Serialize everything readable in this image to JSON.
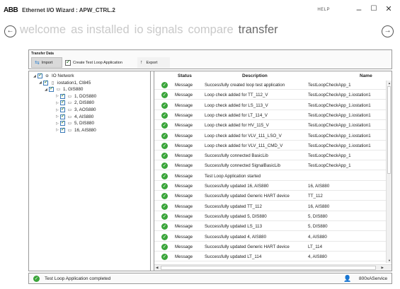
{
  "window": {
    "logo": "ABB",
    "title": "Ethernet I/O Wizard : APW_CTRL.2",
    "help": "HELP"
  },
  "nav": {
    "steps": [
      {
        "label": "welcome",
        "active": false
      },
      {
        "label": "as installed",
        "active": false
      },
      {
        "label": "io signals",
        "active": false
      },
      {
        "label": "compare",
        "active": false
      },
      {
        "label": "transfer",
        "active": true
      }
    ]
  },
  "transfer_data": {
    "title": "Transfer Data",
    "import_label": "Import",
    "create_test_loop_label": "Create Test Loop Application",
    "create_test_loop_checked": true,
    "export_label": "Export"
  },
  "tree": [
    {
      "label": "IO Network",
      "level": 0,
      "expanded": true
    },
    {
      "label": "iostation1, CI845",
      "level": 1,
      "expanded": true
    },
    {
      "label": "1, GIS880",
      "level": 2,
      "expanded": true
    },
    {
      "label": "1, DOS880",
      "level": 3,
      "expanded": false
    },
    {
      "label": "2, DIS880",
      "level": 3,
      "expanded": false
    },
    {
      "label": "3, AOS880",
      "level": 3,
      "expanded": false
    },
    {
      "label": "4, AIS880",
      "level": 3,
      "expanded": false
    },
    {
      "label": "5, DIS880",
      "level": 3,
      "expanded": false
    },
    {
      "label": "16, AIS880",
      "level": 3,
      "expanded": false
    }
  ],
  "grid": {
    "columns": {
      "status": "Status",
      "description": "Description",
      "name": "Name"
    },
    "rows": [
      {
        "status": "Message",
        "description": "Successfully created loop test application",
        "name": "TestLoopCheckApp_1"
      },
      {
        "status": "Message",
        "description": "Loop check added for TT_112_V",
        "name": "TestLoopCheckApp_1.iostation1"
      },
      {
        "status": "Message",
        "description": "Loop check added for LS_113_V",
        "name": "TestLoopCheckApp_1.iostation1"
      },
      {
        "status": "Message",
        "description": "Loop check added for LT_114_V",
        "name": "TestLoopCheckApp_1.iostation1"
      },
      {
        "status": "Message",
        "description": "Loop check added for HV_115_V",
        "name": "TestLoopCheckApp_1.iostation1"
      },
      {
        "status": "Message",
        "description": "Loop check added for VLV_111_LSO_V",
        "name": "TestLoopCheckApp_1.iostation1"
      },
      {
        "status": "Message",
        "description": "Loop check added for VLV_111_CMD_V",
        "name": "TestLoopCheckApp_1.iostation1"
      },
      {
        "status": "Message",
        "description": "Successfully connected BasicLib",
        "name": "TestLoopCheckApp_1"
      },
      {
        "status": "Message",
        "description": "Successfully connected SignalBasicLib",
        "name": "TestLoopCheckApp_1"
      },
      {
        "status": "Message",
        "description": "Test Loop Application started",
        "name": ""
      },
      {
        "status": "Message",
        "description": "Successfully updated 16, AIS880",
        "name": "16, AIS880"
      },
      {
        "status": "Message",
        "description": "Successfully updated Generic HART device",
        "name": "TT_112"
      },
      {
        "status": "Message",
        "description": "Successfully updated TT_112",
        "name": "16, AIS880"
      },
      {
        "status": "Message",
        "description": "Successfully updated 5, DIS880",
        "name": "5, DIS880"
      },
      {
        "status": "Message",
        "description": "Successfully updated LS_113",
        "name": "5, DIS880"
      },
      {
        "status": "Message",
        "description": "Successfully updated 4, AIS880",
        "name": "4, AIS880"
      },
      {
        "status": "Message",
        "description": "Successfully updated Generic HART device",
        "name": "LT_114"
      },
      {
        "status": "Message",
        "description": "Successfully updated LT_114",
        "name": "4, AIS880"
      }
    ]
  },
  "statusbar": {
    "message": "Test Loop Application completed",
    "user": "800xAService"
  },
  "colors": {
    "ok_green": "#3aa53a",
    "step_inactive": "#c9c9c9",
    "step_active": "#6a6a6a"
  }
}
